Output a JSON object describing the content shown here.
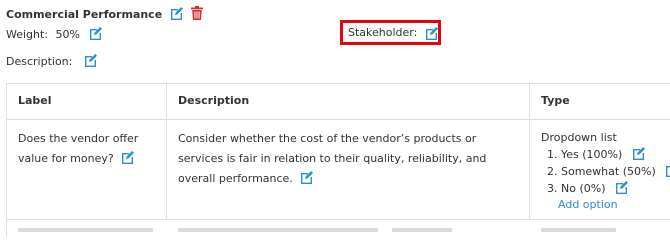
{
  "header": {
    "title": "Commercial Performance",
    "weight_label": "Weight:",
    "weight_value": "50%",
    "stakeholder_label": "Stakeholder:",
    "description_label": "Description:"
  },
  "table": {
    "columns": [
      "Label",
      "Description",
      "Type"
    ],
    "rows": [
      {
        "label": "Does the vendor offer value for money?",
        "description": "Consider whether the cost of the vendor’s products or services is fair in relation to their quality, reliability, and overall performance.",
        "type": "Dropdown list",
        "options": [
          "1. Yes (100%)",
          "2. Somewhat (50%)",
          "3. No (0%)"
        ],
        "add_option_label": "Add option"
      }
    ]
  },
  "colors": {
    "edit_icon": "#2a8fd0",
    "delete_icon": "#d32f2f",
    "highlight_box": "#e8000b",
    "link": "#2a8fd0"
  },
  "icons": {
    "edit": "edit-icon",
    "delete": "trash-icon"
  }
}
